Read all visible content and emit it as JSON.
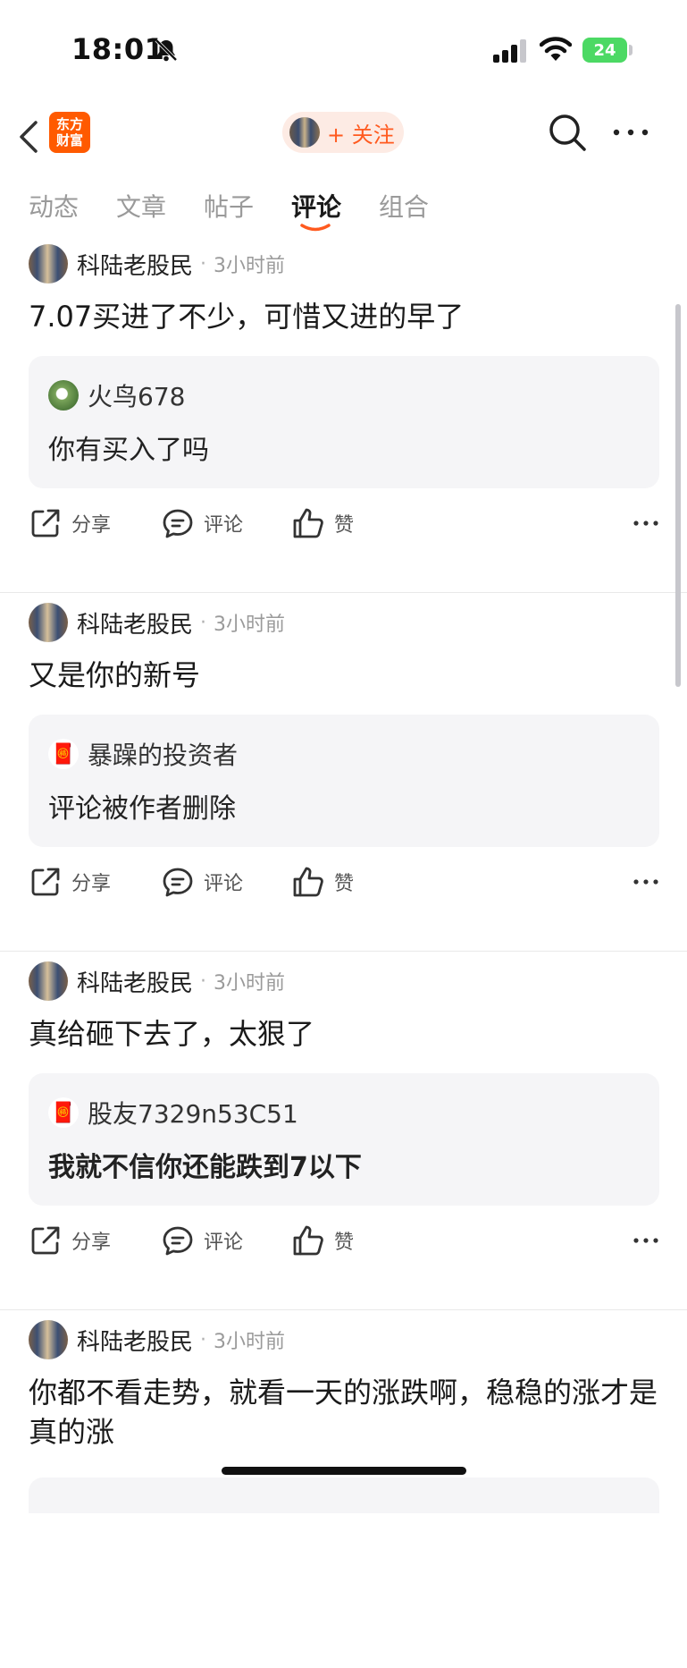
{
  "status_bar": {
    "time": "18:01",
    "battery": "24"
  },
  "nav": {
    "logo_line1": "东方",
    "logo_line2": "财富",
    "follow": "+ 关注"
  },
  "tabs": [
    {
      "label": "动态"
    },
    {
      "label": "文章"
    },
    {
      "label": "帖子"
    },
    {
      "label": "评论",
      "active": true
    },
    {
      "label": "组合"
    }
  ],
  "actions": {
    "share": "分享",
    "comment": "评论",
    "like": "赞"
  },
  "posts": [
    {
      "author": "科陆老股民",
      "dot": "·",
      "time": "3小时前",
      "content": "7.07买进了不少，可惜又进的早了",
      "reply": {
        "name": "火鸟678",
        "text": "你有买入了吗",
        "bold": false,
        "avatar": "green"
      }
    },
    {
      "author": "科陆老股民",
      "dot": "·",
      "time": "3小时前",
      "content": "又是你的新号",
      "reply": {
        "name": "暴躁的投资者",
        "text": "评论被作者删除",
        "bold": false,
        "avatar": "god"
      }
    },
    {
      "author": "科陆老股民",
      "dot": "·",
      "time": "3小时前",
      "content": "真给砸下去了，太狠了",
      "reply": {
        "name": "股友7329n53C51",
        "text": "我就不信你还能跌到7以下",
        "bold": true,
        "avatar": "god"
      }
    },
    {
      "author": "科陆老股民",
      "dot": "·",
      "time": "3小时前",
      "content": "你都不看走势，就看一天的涨跌啊，稳稳的涨才是真的涨"
    }
  ],
  "colors": {
    "accent": "#ff5a1f",
    "logo": "#ff5a00",
    "battery": "#4cd964"
  }
}
